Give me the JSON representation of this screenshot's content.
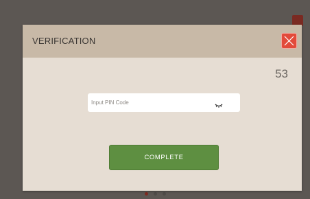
{
  "dialog": {
    "title": "VERIFICATION",
    "countdown": "53",
    "pin_input": {
      "placeholder": "Input PIN Code",
      "value": ""
    },
    "complete_label": "COMPLETE",
    "close_icon": "close-icon",
    "visibility_icon": "eye-closed-icon"
  },
  "background": {
    "carousel_dots": 3,
    "active_dot": 0
  },
  "colors": {
    "header_bg": "#c8b9a7",
    "modal_bg": "#e6ddd3",
    "close_button": "#e24a3b",
    "complete_button": "#5e8f41"
  }
}
